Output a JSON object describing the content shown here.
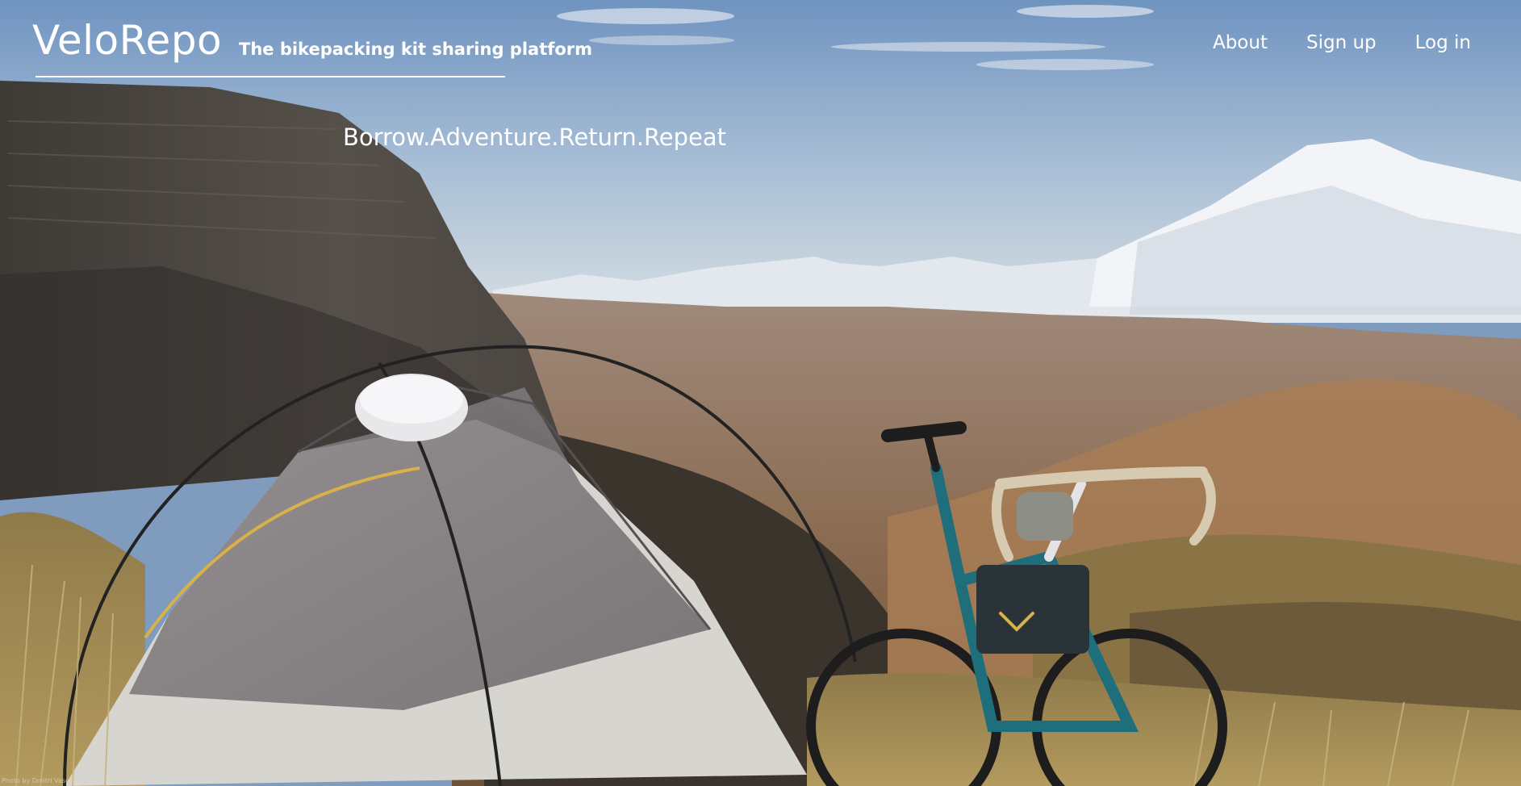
{
  "brand": {
    "name": "VeloRepo",
    "tagline": "The bikepacking kit sharing platform"
  },
  "nav": {
    "items": [
      {
        "label": "About"
      },
      {
        "label": "Sign up"
      },
      {
        "label": "Log in"
      }
    ]
  },
  "hero": {
    "slogan": "Borrow.Adventure.Return.Repeat",
    "photo_credit": "Photo by Dmitri Vaschenko on Unsplash"
  },
  "colors": {
    "sky_top": "#6f93c0",
    "sky_bottom": "#c6d3df",
    "text": "#ffffff",
    "tent_body": "#d6d4cf",
    "frame_teal": "#1f6e7c"
  }
}
